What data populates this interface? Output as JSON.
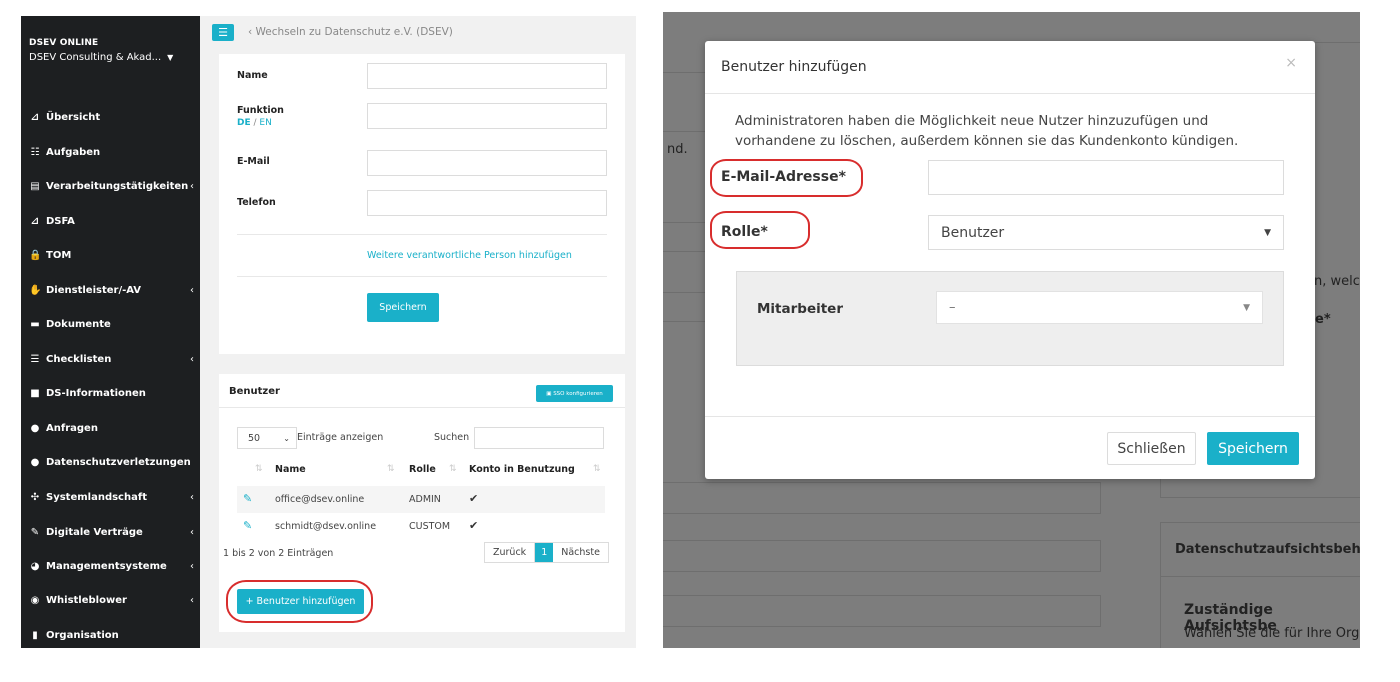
{
  "left": {
    "sidebar": {
      "brand": "DSEV ONLINE",
      "org": "DSEV Consulting & Akad...",
      "items": [
        {
          "label": "Übersicht",
          "icon": "chart-icon",
          "glyph": "⊿",
          "chevron": ""
        },
        {
          "label": "Aufgaben",
          "icon": "tasks-icon",
          "glyph": "☷",
          "chevron": ""
        },
        {
          "label": "Verarbeitungstätigkeiten",
          "icon": "table-icon",
          "glyph": "▤",
          "chevron": "‹"
        },
        {
          "label": "DSFA",
          "icon": "area-chart-icon",
          "glyph": "⊿",
          "chevron": ""
        },
        {
          "label": "TOM",
          "icon": "lock-icon",
          "glyph": "🔒",
          "chevron": ""
        },
        {
          "label": "Dienstleister/-AV",
          "icon": "handshake-icon",
          "glyph": "✋",
          "chevron": "‹"
        },
        {
          "label": "Dokumente",
          "icon": "folder-icon",
          "glyph": "▬",
          "chevron": ""
        },
        {
          "label": "Checklisten",
          "icon": "list-icon",
          "glyph": "☰",
          "chevron": "‹"
        },
        {
          "label": "DS-Informationen",
          "icon": "info-box-icon",
          "glyph": "■",
          "chevron": ""
        },
        {
          "label": "Anfragen",
          "icon": "comments-icon",
          "glyph": "●",
          "chevron": ""
        },
        {
          "label": "Datenschutzverletzungen",
          "icon": "alert-icon",
          "glyph": "●",
          "chevron": ""
        },
        {
          "label": "Systemlandschaft",
          "icon": "network-icon",
          "glyph": "✣",
          "chevron": "‹"
        },
        {
          "label": "Digitale Verträge",
          "icon": "contract-icon",
          "glyph": "✎",
          "chevron": "‹"
        },
        {
          "label": "Managementsysteme",
          "icon": "dashboard-icon",
          "glyph": "◕",
          "chevron": "‹"
        },
        {
          "label": "Whistleblower",
          "icon": "whistle-icon",
          "glyph": "◉",
          "chevron": "‹"
        },
        {
          "label": "Organisation",
          "icon": "building-icon",
          "glyph": "▮",
          "chevron": ""
        }
      ]
    },
    "topbar": {
      "menu_glyph": "☰",
      "switch_text": "‹  Wechseln zu Datenschutz e.V. (DSEV)"
    },
    "form": {
      "name_label": "Name",
      "function_label": "Funktion",
      "lang_de": "DE",
      "lang_sep": " / ",
      "lang_en": "EN",
      "email_label": "E-Mail",
      "phone_label": "Telefon",
      "add_person_link": "Weitere verantwortliche Person hinzufügen",
      "save_label": "Speichern"
    },
    "users": {
      "title": "Benutzer",
      "sso_button": "▣ SSO konfigurieren",
      "length_value": "50",
      "length_text": "Einträge anzeigen",
      "search_label": "Suchen",
      "columns": [
        "Name",
        "Rolle",
        "Konto in Benutzung"
      ],
      "rows": [
        {
          "name": "office@dsev.online",
          "role": "ADMIN"
        },
        {
          "name": "schmidt@dsev.online",
          "role": "CUSTOM"
        }
      ],
      "info": "1 bis 2 von 2 Einträgen",
      "pager": {
        "prev": "Zurück",
        "current": "1",
        "next": "Nächste"
      },
      "add_button": "+ Benutzer hinzufügen"
    }
  },
  "right": {
    "background": {
      "text1": "nd.",
      "text2": "n, welc",
      "text3": "e*",
      "text4": "Datenschutzaufsichtsbeh",
      "text5": "Zuständige Aufsichtsbe",
      "text6": "Wählen Sie die für Ihre Org"
    },
    "modal": {
      "title": "Benutzer hinzufügen",
      "close_glyph": "×",
      "description": "Administratoren haben die Möglichkeit neue Nutzer hinzuzufügen und vorhandene zu löschen, außerdem können sie das Kundenkonto kündigen.",
      "email_label": "E-Mail-Adresse*",
      "role_label": "Rolle*",
      "role_value": "Benutzer",
      "employee_label": "Mitarbeiter",
      "employee_value": "–",
      "close_button": "Schließen",
      "save_button": "Speichern"
    }
  },
  "colors": {
    "accent": "#1ab0c9",
    "highlight": "#d82d2d",
    "sidebar": "#1d1f21"
  }
}
